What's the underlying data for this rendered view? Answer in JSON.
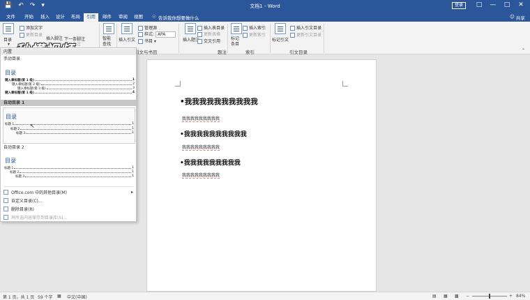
{
  "titlebar": {
    "title": "文档1 - Word",
    "login": "登录",
    "save_icon": "save-icon",
    "undo_icon": "undo-icon",
    "redo_icon": "redo-icon"
  },
  "tabs": [
    {
      "label": "文件"
    },
    {
      "label": "开始"
    },
    {
      "label": "插入"
    },
    {
      "label": "设计"
    },
    {
      "label": "布局"
    },
    {
      "label": "引用"
    },
    {
      "label": "邮件"
    },
    {
      "label": "审阅"
    },
    {
      "label": "视图"
    }
  ],
  "tellme": {
    "placeholder": "告诉我你想要做什么"
  },
  "share": {
    "label": "共享"
  },
  "ribbon": {
    "toc": {
      "label": "目录",
      "add_text": "添加文字",
      "update_table": "更新目录"
    },
    "footnote": {
      "insert": "插入脚注",
      "next": "下一条脚注",
      "show": "显示备注"
    },
    "research": {
      "label": "智能查找"
    },
    "citation": {
      "insert": "插入引文",
      "manage": "管理源",
      "style_label": "样式:",
      "style_value": "APA",
      "bibliography": "书目"
    },
    "caption": {
      "insert_caption": "插入题注",
      "insert_table_figures": "插入表目录",
      "update_table": "更新表格",
      "cross_ref": "交叉引用"
    },
    "index": {
      "mark_entry": "标记条目",
      "insert_index": "插入索引",
      "update_index": "更新索引"
    },
    "toa": {
      "mark_citation": "标记引文",
      "insert_toa": "插入引文目录",
      "update_toa": "更新引文目录"
    },
    "groups": {
      "citations": "引文与书目",
      "captions": "题注",
      "index": "索引",
      "toa": "引文目录"
    }
  },
  "watermark": "秒懂视频",
  "panel": {
    "builtin": "内置",
    "manual_toc": "手动目录",
    "manual_toc_title": "目录",
    "manual_lines": [
      {
        "text": "键入章标题(第 1 级)",
        "page": "1"
      },
      {
        "text": "键入章标题(第 2 级)",
        "page": "2"
      },
      {
        "text": "键入章标题(第 3 级)",
        "page": "3"
      },
      {
        "text": "键入章标题(第 1 级)",
        "page": "4"
      }
    ],
    "auto_toc1": "自动目录 1",
    "auto_toc1_title": "目录",
    "auto1_lines": [
      {
        "text": "标题 1",
        "page": "1"
      },
      {
        "text": "标题 2",
        "page": "1"
      },
      {
        "text": "标题 3",
        "page": "1"
      }
    ],
    "auto_toc2": "自动目录 2",
    "auto_toc2_title": "目录",
    "auto2_lines": [
      {
        "text": "标题 1",
        "page": "1"
      },
      {
        "text": "标题 2",
        "page": "1"
      },
      {
        "text": "标题 3",
        "page": "1"
      }
    ],
    "more": "Office.com 中的其他目录(M)",
    "custom": "自定义目录(C)...",
    "remove": "删除目录(R)",
    "save_selection": "将所选内容保存到目录库(S)..."
  },
  "document": {
    "heading1a": "我我我我我我我我我我",
    "body1": "我我我我我我我我我",
    "heading2": "我我我我我我我我我我",
    "body2": "我我我我我我我我我",
    "heading1b": "我我我我我我我我我",
    "body3": "我我我我我我我我我"
  },
  "status": {
    "page": "第 1 页，共 1 页",
    "words": "59 个字",
    "lang": "中文(中国)",
    "zoom": "84%"
  }
}
